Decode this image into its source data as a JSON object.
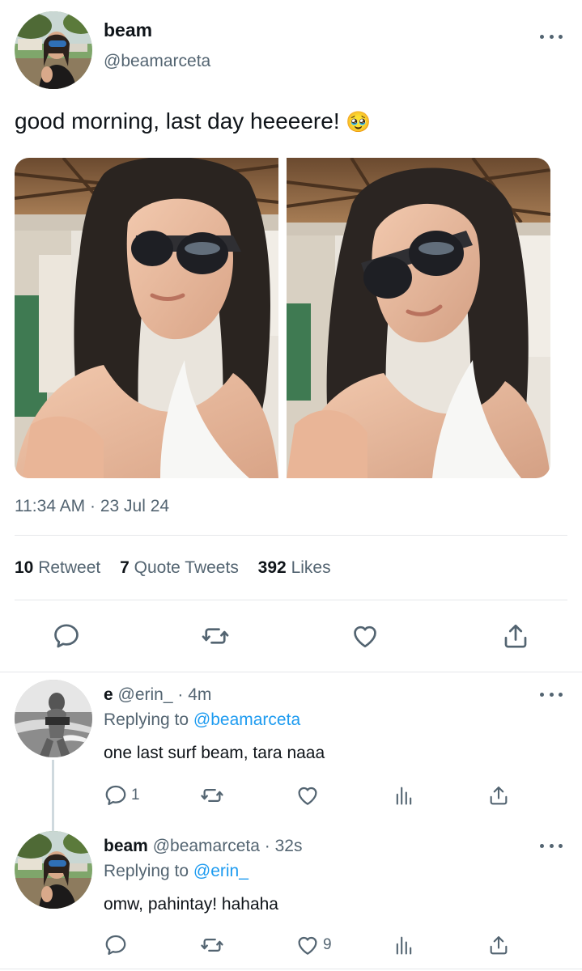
{
  "tweet": {
    "display_name": "beam",
    "handle": "@beamarceta",
    "text": "good morning, last day heeeere!",
    "emoji": "🥹",
    "timestamp": "11:34 AM · 23 Jul 24",
    "stats": {
      "retweets_count": "10",
      "retweets_label": "Retweet",
      "quotes_count": "7",
      "quotes_label": "Quote Tweets",
      "likes_count": "392",
      "likes_label": "Likes"
    }
  },
  "replies": [
    {
      "display_name": "e",
      "handle": "@erin_",
      "time": "· 4m",
      "replying_prefix": "Replying to",
      "replying_to": "@beamarceta",
      "text": "one last surf beam, tara naaa",
      "reply_count": "1",
      "like_count": ""
    },
    {
      "display_name": "beam",
      "handle": "@beamarceta",
      "time": "· 32s",
      "replying_prefix": "Replying to",
      "replying_to": "@erin_",
      "text": "omw, pahintay! hahaha",
      "reply_count": "",
      "like_count": "9"
    }
  ],
  "colors": {
    "text": "#0f1419",
    "secondary": "#536471",
    "link": "#1d9bf0",
    "divider": "#e5e7ea"
  },
  "icons": [
    "more-icon",
    "reply-icon",
    "retweet-icon",
    "like-icon",
    "share-icon",
    "analytics-icon"
  ]
}
